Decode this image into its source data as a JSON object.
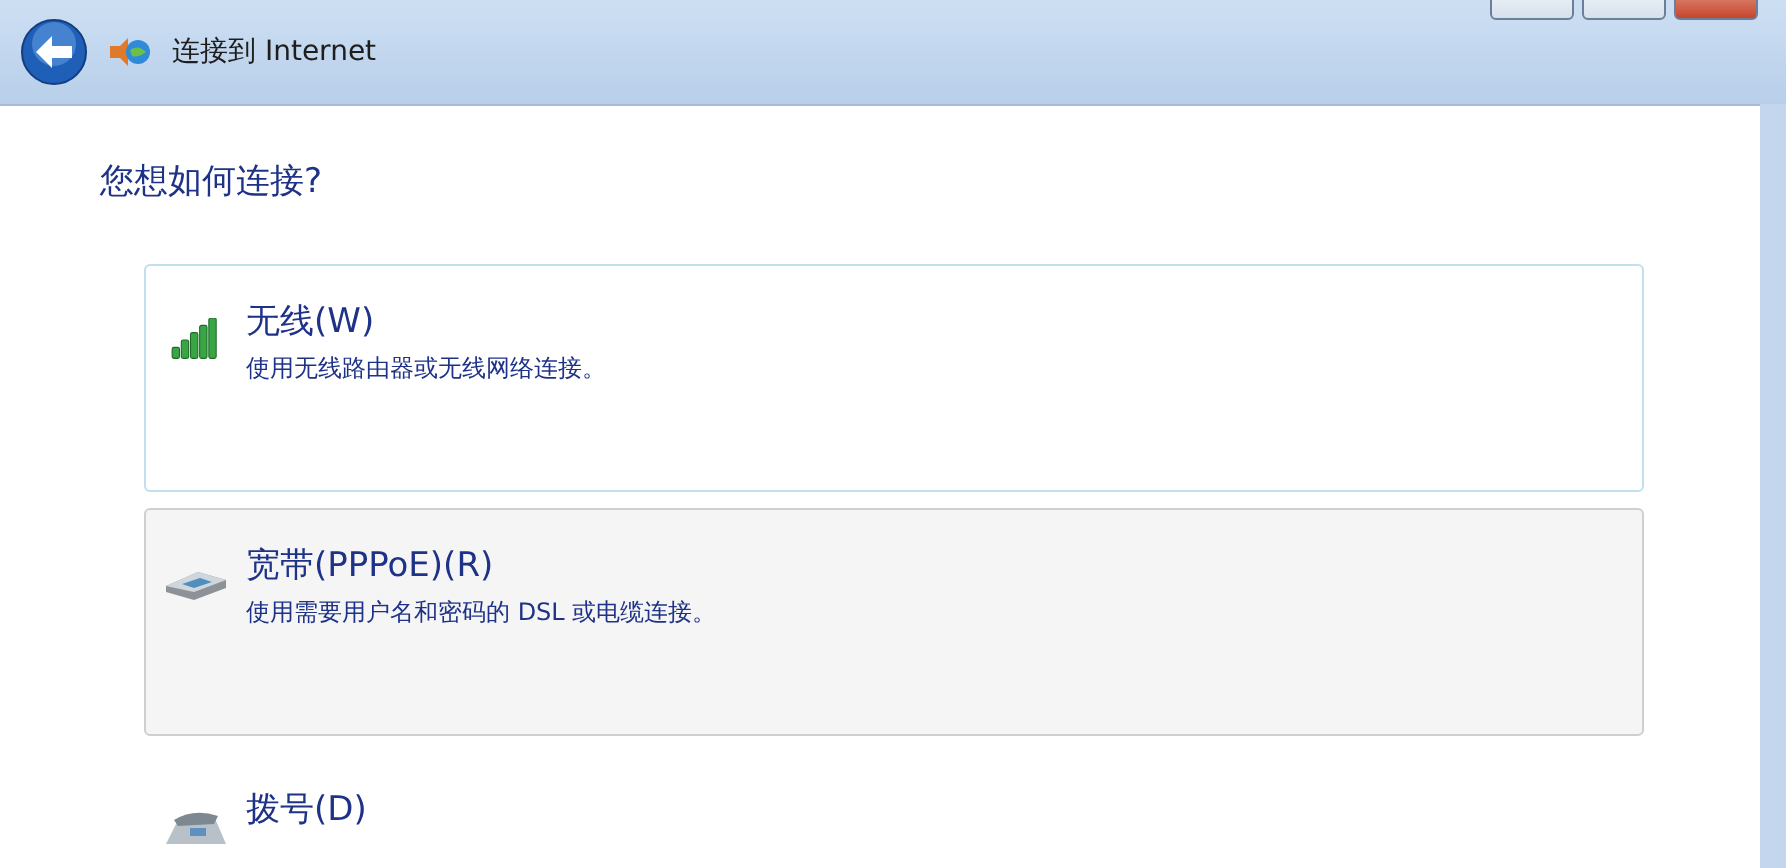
{
  "window": {
    "title": "连接到 Internet"
  },
  "heading": "您想如何连接?",
  "options": [
    {
      "kind": "wireless",
      "title": "无线(W)",
      "description": "使用无线路由器或无线网络连接。",
      "hovered": true,
      "selected": false
    },
    {
      "kind": "broadband",
      "title": "宽带(PPPoE)(R)",
      "description": "使用需要用户名和密码的 DSL 或电缆连接。",
      "hovered": false,
      "selected": true
    },
    {
      "kind": "dialup",
      "title": "拨号(D)",
      "hovered": false,
      "selected": false
    }
  ]
}
